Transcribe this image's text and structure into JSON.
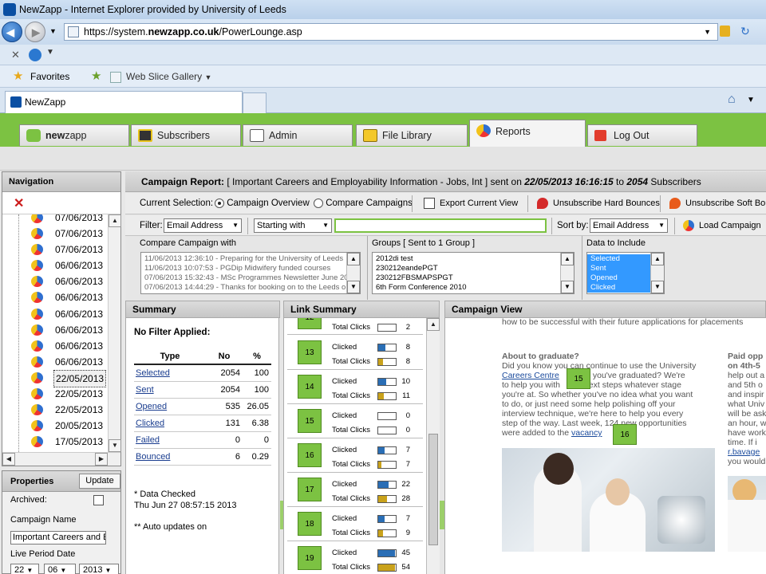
{
  "browser": {
    "window_title": "NewZapp - Internet Explorer provided by University of Leeds",
    "url_prefix": "https://system.",
    "url_host": "newzapp.co.uk",
    "url_path": "/PowerLounge.asp",
    "favorites_label": "Favorites",
    "web_slice_label": "Web Slice Gallery",
    "tab_title": "NewZapp"
  },
  "app_tabs": {
    "logo_bold": "new",
    "logo_rest": "zapp",
    "subscribers": "Subscribers",
    "admin": "Admin",
    "file_library": "File Library",
    "reports": "Reports",
    "log_out": "Log Out"
  },
  "navigation": {
    "title": "Navigation",
    "partial_top": "07/06/2013",
    "items": [
      "07/06/2013",
      "07/06/2013",
      "06/06/2013",
      "06/06/2013",
      "06/06/2013",
      "06/06/2013",
      "06/06/2013",
      "06/06/2013",
      "06/06/2013",
      "22/05/2013",
      "22/05/2013",
      "22/05/2013",
      "20/05/2013",
      "17/05/2013"
    ],
    "selected_index": 9
  },
  "properties": {
    "title": "Properties",
    "update_label": "Update",
    "archived_label": "Archived:",
    "campaign_name_label": "Campaign Name",
    "campaign_name_value": "Important Careers and E",
    "live_period_label": "Live Period Date",
    "day": "22",
    "month": "06",
    "year": "2013"
  },
  "report": {
    "prefix": "Campaign Report:",
    "campaign_name": "[ Important Careers and Employability Information - Jobs, Int ]",
    "sent_on_label": "sent on",
    "sent_date": "22/05/2013 16:16:15",
    "to_label": "to",
    "subscriber_count": "2054",
    "subscribers_label": "Subscribers"
  },
  "selection": {
    "label": "Current Selection:",
    "option_overview": "Campaign Overview",
    "option_compare": "Compare Campaigns",
    "export": "Export Current View",
    "unsub_hard": "Unsubscribe Hard Bounces",
    "unsub_soft": "Unsubscribe Soft Bou"
  },
  "filter": {
    "label": "Filter:",
    "field": "Email Address",
    "mode": "Starting with",
    "value": "",
    "sort_label": "Sort by:",
    "sort_field": "Email Address",
    "load_campaign": "Load Campaign"
  },
  "compare": {
    "label": "Compare Campaign with",
    "items": [
      "11/06/2013 12:36:10 - Preparing for the University of Leeds",
      "11/06/2013 10:07:53 - PGDip Midwifery funded courses",
      "07/06/2013 15:32:43 - MSc Programmes Newsletter June 20",
      "07/06/2013 14:44:29 - Thanks for booking on to the Leeds o"
    ]
  },
  "groups": {
    "label": "Groups [ Sent to 1 Group ]",
    "items": [
      "2012di test",
      "230212eandePGT",
      "230212FBSMAPSPGT",
      "6th Form Conference 2010"
    ]
  },
  "data_include": {
    "label": "Data to Include",
    "items": [
      "Selected",
      "Sent",
      "Opened",
      "Clicked"
    ]
  },
  "summary": {
    "header": "Summary",
    "filter_status": "No Filter Applied:",
    "col_type": "Type",
    "col_no": "No",
    "col_pct": "%",
    "rows": [
      {
        "type": "Selected",
        "no": "2054",
        "pct": "100"
      },
      {
        "type": "Sent",
        "no": "2054",
        "pct": "100"
      },
      {
        "type": "Opened",
        "no": "535",
        "pct": "26.05"
      },
      {
        "type": "Clicked",
        "no": "131",
        "pct": "6.38"
      },
      {
        "type": "Failed",
        "no": "0",
        "pct": "0"
      },
      {
        "type": "Bounced",
        "no": "6",
        "pct": "0.29"
      }
    ],
    "data_checked_label": "* Data Checked",
    "data_checked_time": "Thu Jun 27 08:57:15 2013",
    "auto_updates": "** Auto updates on"
  },
  "link_summary": {
    "header": "Link Summary",
    "clicked_label": "Clicked",
    "total_label": "Total Clicks",
    "partial_link": {
      "id": "12",
      "total": "2",
      "total_fill": 0.0
    },
    "links": [
      {
        "id": "13",
        "clicked": "8",
        "total": "8",
        "clicked_fill": 0.4,
        "total_fill": 0.25
      },
      {
        "id": "14",
        "clicked": "10",
        "total": "11",
        "clicked_fill": 0.45,
        "total_fill": 0.3
      },
      {
        "id": "15",
        "clicked": "0",
        "total": "0",
        "clicked_fill": 0.0,
        "total_fill": 0.0
      },
      {
        "id": "16",
        "clicked": "7",
        "total": "7",
        "clicked_fill": 0.35,
        "total_fill": 0.2
      },
      {
        "id": "17",
        "clicked": "22",
        "total": "28",
        "clicked_fill": 0.6,
        "total_fill": 0.5
      },
      {
        "id": "18",
        "clicked": "7",
        "total": "9",
        "clicked_fill": 0.35,
        "total_fill": 0.25
      },
      {
        "id": "19",
        "clicked": "45",
        "total": "54",
        "clicked_fill": 0.95,
        "total_fill": 0.95
      }
    ]
  },
  "campaign_view": {
    "header": "Campaign View",
    "intro_line": "how to be successful with their future applications for placements",
    "grad_heading": "About to graduate?",
    "grad_lines": [
      "Did you know you can continue to use the University",
      "fter you've graduated?  We're",
      "to help you with",
      "next steps whatever stage",
      "you're at. So whether you've no idea what you want",
      "to do, or just need some help polishing off your",
      "interview technique, we're here to help you every",
      "step of the way.  Last week, 124 new opportunities",
      "were added to the"
    ],
    "careers_link": "Careers Centre",
    "vacancy_link": "vacancy",
    "badge_a": "15",
    "badge_b": "16",
    "right_heading_1": "Paid opp",
    "right_heading_2": "on 4th-5",
    "right_lines": [
      "help out a",
      "and 5th o",
      "and inspir",
      "what Univ",
      "will be ask",
      "an hour, w",
      "have work",
      "time.  If i"
    ],
    "right_link": "r.bavage",
    "right_tail": "you would"
  },
  "colors": {
    "app_green": "#7cc242",
    "link_blue": "#1a3d8f",
    "bar_blue": "#2a6eb5",
    "bar_gold": "#c9a21b"
  }
}
